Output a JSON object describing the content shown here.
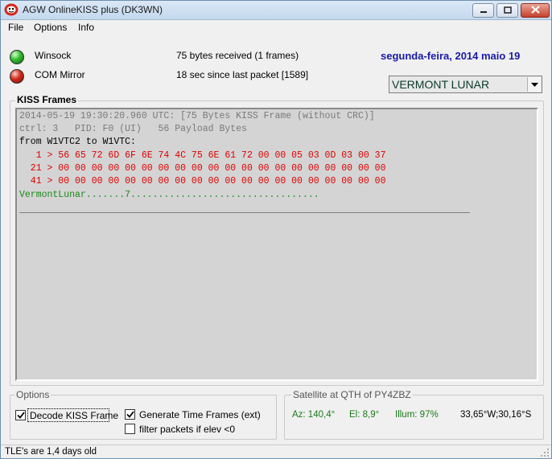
{
  "window": {
    "title": "AGW OnlineKISS plus (DK3WN)"
  },
  "menu": {
    "items": [
      "File",
      "Options",
      "Info"
    ]
  },
  "status": {
    "winsock_label": "Winsock",
    "com_label": "COM Mirror",
    "received": "75 bytes received (1 frames)",
    "since_last": "18 sec since last packet [1589]",
    "date": "segunda-feira, 2014 maio 19"
  },
  "satellite_select": {
    "value": "VERMONT LUNAR"
  },
  "kiss": {
    "title": "KISS Frames",
    "lines": [
      "2014-05-19 19:30:20.960 UTC: [75 Bytes KISS Frame (without CRC)]",
      "ctrl: 3   PID: F0 (UI)   56 Payload Bytes",
      "from W1VTC2 to W1VTC:",
      "   1 > 56 65 72 6D 6F 6E 74 4C 75 6E 61 72 00 00 05 03 0D 03 00 37",
      "  21 > 00 00 00 00 00 00 00 00 00 00 00 00 00 00 00 00 00 00 00 00",
      "  41 > 00 00 00 00 00 00 00 00 00 00 00 00 00 00 00 00 00 00 00 00",
      "VermontLunar.......7.................................."
    ]
  },
  "options": {
    "title": "Options",
    "decode_label": "Decode KISS Frame",
    "decode_checked": true,
    "generate_label": "Generate Time Frames (ext)",
    "generate_checked": true,
    "filter_label": "filter packets if elev <0",
    "filter_checked": false
  },
  "satellite": {
    "title": "Satellite at QTH of PY4ZBZ",
    "az": "Az: 140,4°",
    "el": "El: 8,9°",
    "illum": "Illum: 97%",
    "coords": "33,65°W;30,16°S"
  },
  "statusbar": {
    "text": "TLE's are 1,4 days old"
  },
  "colors": {
    "date_blue": "#1a1aa8",
    "hex_red": "#e00000",
    "ascii_green": "#1a8a1a",
    "header_gray": "#7a7a7a"
  }
}
